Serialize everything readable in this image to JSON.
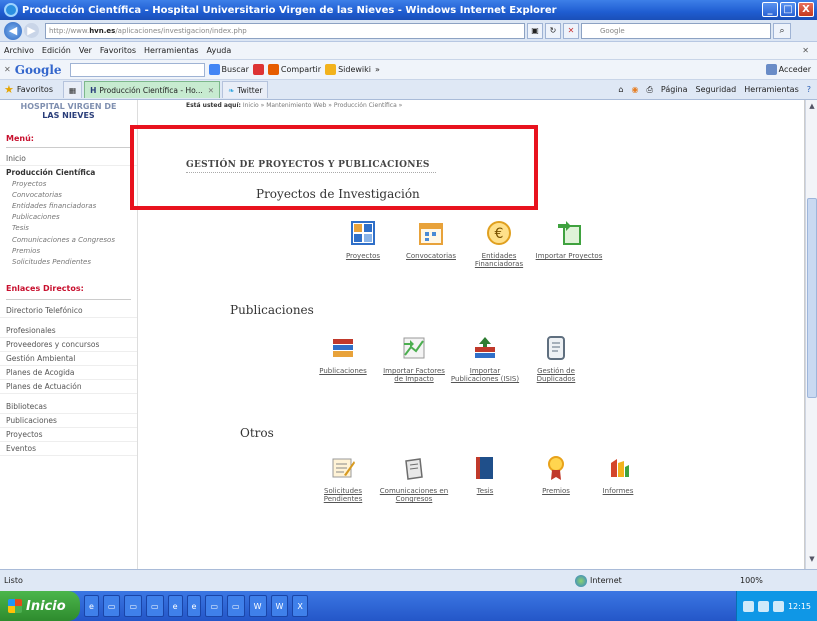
{
  "window": {
    "title": "Producción Científica - Hospital Universitario Virgen de las Nieves - Windows Internet Explorer",
    "btn_min": "_",
    "btn_max": "□",
    "btn_close": "X"
  },
  "address": {
    "url_prefix": "http://www.",
    "url_domain": "hvn.es",
    "url_path": "/aplicaciones/investigacion/index.php",
    "search_placeholder": "Google"
  },
  "menubar": [
    "Archivo",
    "Edición",
    "Ver",
    "Favoritos",
    "Herramientas",
    "Ayuda"
  ],
  "googlebar": {
    "label": "Google",
    "buscar": "Buscar",
    "compartir": "Compartir",
    "sidewiki": "Sidewiki",
    "more": "»",
    "acceder": "Acceder"
  },
  "tabs": {
    "favorites": "Favoritos",
    "items": [
      {
        "label": "Producción Científica - Ho..."
      },
      {
        "label": "Twitter"
      }
    ],
    "cmd": [
      "Página",
      "Seguridad",
      "Herramientas"
    ]
  },
  "sidebar": {
    "hospital_line1": "HOSPITAL VIRGEN DE",
    "hospital_line2": "LAS NIEVES",
    "menu_heading": "Menú:",
    "inicio": "Inicio",
    "produccion": "Producción Científica",
    "sub_items": [
      "Proyectos",
      "Convocatorias",
      "Entidades financiadoras",
      "Publicaciones",
      "Tesis",
      "Comunicaciones a Congresos",
      "Premios",
      "Solicitudes Pendientes"
    ],
    "links_heading": "Enlaces Directos:",
    "links1": [
      "Directorio Telefónico"
    ],
    "links2": [
      "Profesionales",
      "Proveedores y concursos",
      "Gestión Ambiental",
      "Planes de Acogida",
      "Planes de Actuación"
    ],
    "links3": [
      "Bibliotecas",
      "Publicaciones",
      "Proyectos",
      "Eventos"
    ]
  },
  "main": {
    "breadcrumb_label": "Está usted aquí:",
    "breadcrumb_path": "Inicio » Mantenimiento Web » Producción Científica »",
    "section_title": "GESTIÓN DE PROYECTOS Y PUBLICACIONES",
    "groups": [
      {
        "title": "Proyectos de Investigación",
        "items": [
          {
            "label": "Proyectos",
            "icon": "table-icon",
            "color": "#2f6fc8"
          },
          {
            "label": "Convocatorias",
            "icon": "calendar-icon",
            "color": "#e8a23a"
          },
          {
            "label": "Entidades Financiadoras",
            "icon": "euro-icon",
            "color": "#e0a020"
          },
          {
            "label": "Importar Proyectos",
            "icon": "import-sheet-icon",
            "color": "#3fa23f"
          }
        ]
      },
      {
        "title": "Publicaciones",
        "items": [
          {
            "label": "Publicaciones",
            "icon": "books-icon",
            "color": "#c0392b"
          },
          {
            "label": "Importar Factores de Impacto",
            "icon": "import-chart-icon",
            "color": "#4caf50"
          },
          {
            "label": "Importar Publicaciones (ISIS)",
            "icon": "import-books-icon",
            "color": "#2e7d32"
          },
          {
            "label": "Gestión de Duplicados",
            "icon": "duplicates-icon",
            "color": "#5f6f7f"
          }
        ]
      },
      {
        "title": "Otros",
        "items": [
          {
            "label": "Solicitudes Pendientes",
            "icon": "pending-note-icon",
            "color": "#d79a20"
          },
          {
            "label": "Comunicaciones en Congresos",
            "icon": "podium-icon",
            "color": "#6d6d6d"
          },
          {
            "label": "Tesis",
            "icon": "book-icon",
            "color": "#1f4f8a"
          },
          {
            "label": "Premios",
            "icon": "award-icon",
            "color": "#e8a21a"
          },
          {
            "label": "Informes",
            "icon": "report-icon",
            "color": "#d4452a"
          }
        ]
      }
    ]
  },
  "status": {
    "left": "Listo",
    "zone": "Internet",
    "zoom": "100%"
  },
  "taskbar": {
    "start": "Inicio",
    "time": "12:15"
  },
  "colors": {
    "accent_red": "#e8121e",
    "menu_red": "#c8102e",
    "hospital_blue": "#2a3e7a"
  }
}
